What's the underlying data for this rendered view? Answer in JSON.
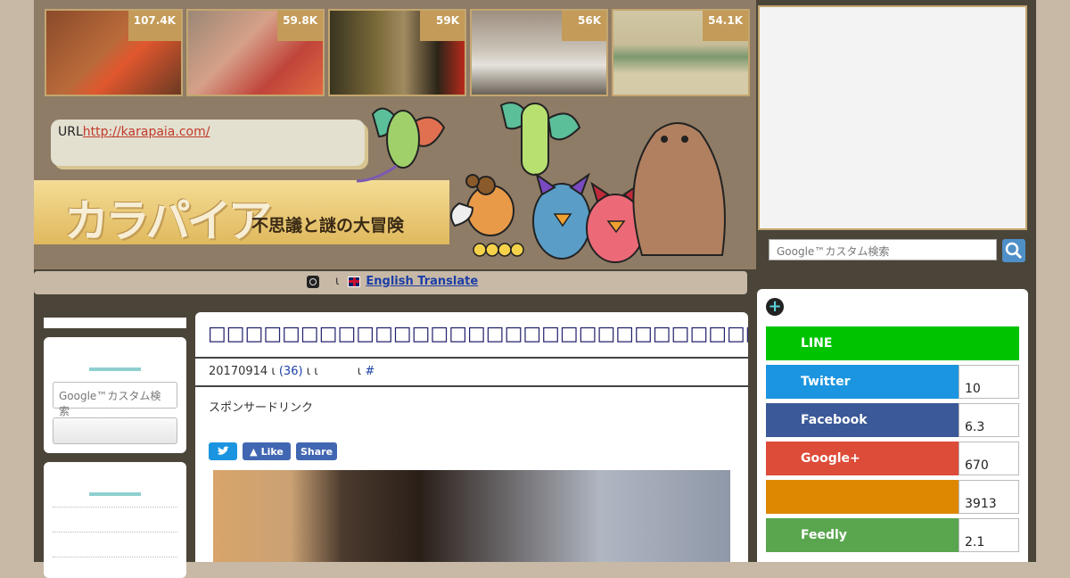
{
  "thumbnails": [
    {
      "count": "107.4K",
      "colors": [
        "#8a4a2a",
        "#e0572e"
      ]
    },
    {
      "count": "59.8K",
      "colors": [
        "#d6a088",
        "#c0443a"
      ]
    },
    {
      "count": "59K",
      "colors": [
        "#3a3520",
        "#7b6a3a"
      ]
    },
    {
      "count": "56K",
      "colors": [
        "#9d8f80",
        "#e6e2dc"
      ]
    },
    {
      "count": "54.1K",
      "colors": [
        "#d2c7a4",
        "#7c9970"
      ]
    }
  ],
  "site": {
    "url_label": "URL",
    "url": "http://karapaia.com/",
    "logo_text": "カラパイア",
    "tagline": "不思議と謎の大冒険"
  },
  "translate": {
    "sep": "ι",
    "label": "English Translate"
  },
  "search": {
    "placeholder": "Google™カスタム検索"
  },
  "article": {
    "title": "□□□□□□□□□□□□□□□□□□□□□□□□□□□□□□□□□□□□□",
    "date": "20170914",
    "sep1": "ι",
    "comments": "(36)",
    "sep2": "ι",
    "sep3": "ι",
    "sep4": "ι",
    "sep5": "ι",
    "hash": "#",
    "sponsor": "スポンサードリンク",
    "share_like": "Like",
    "share_share": "Share"
  },
  "social": [
    {
      "label": "LINE",
      "count": "",
      "color": "#00c300"
    },
    {
      "label": "Twitter",
      "count": "10",
      "color": "#1b95e0"
    },
    {
      "label": "Facebook",
      "count": "6.3",
      "color": "#3b5998"
    },
    {
      "label": "Google+",
      "count": "670",
      "color": "#dd4b39"
    },
    {
      "label": "",
      "count": "3913",
      "color": "#dd8800"
    },
    {
      "label": "Feedly",
      "count": "2.1",
      "color": "#5aa64f"
    }
  ]
}
